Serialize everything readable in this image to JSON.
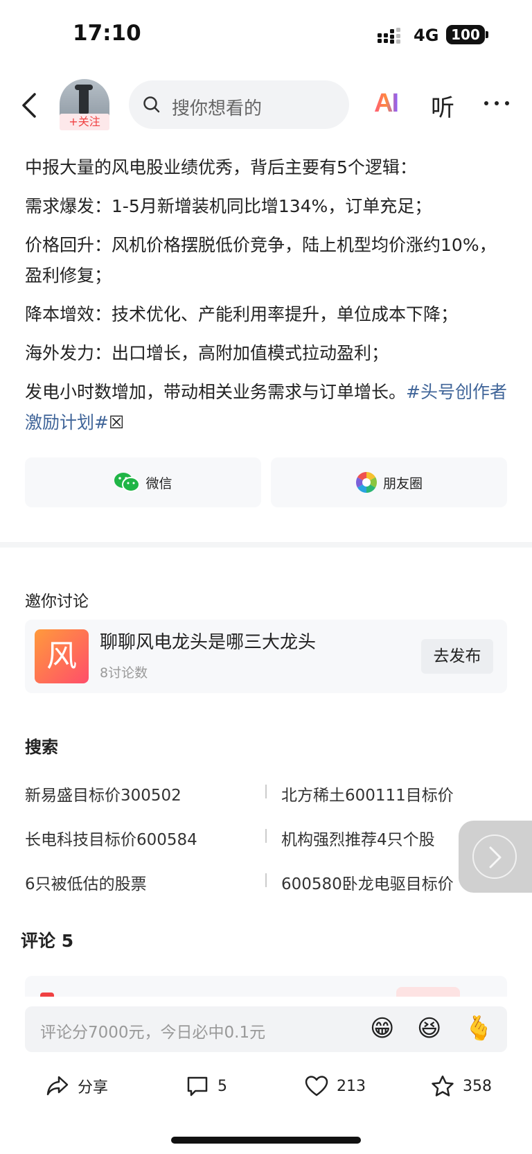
{
  "status_bar": {
    "time": "17:10",
    "network": "4G",
    "battery": "100"
  },
  "header": {
    "follow_label": "+关注",
    "search_placeholder": "搜你想看的",
    "ai_label": "AI",
    "listen_label": "听"
  },
  "article": {
    "paragraphs": [
      "中报大量的风电股业绩优秀，背后主要有5个逻辑：",
      "需求爆发：1-5月新增装机同比增134%，订单充足；",
      "价格回升：风机价格摆脱低价竞争，陆上机型均价涨约10%，盈利修复；",
      "降本增效：技术优化、产能利用率提升，单位成本下降；",
      "海外发力：出口增长，高附加值模式拉动盈利；",
      "发电小时数增加，带动相关业务需求与订单增长。"
    ],
    "hashtag": "#头号创作者激励计划#",
    "trailing_glyph": "☒"
  },
  "share": {
    "wechat_label": "微信",
    "moments_label": "朋友圈"
  },
  "discussion": {
    "section_title": "邀你讨论",
    "thumb_char": "风",
    "topic_title": "聊聊风电龙头是哪三大龙头",
    "topic_count": "8讨论数",
    "publish_label": "去发布"
  },
  "search_section": {
    "title": "搜索",
    "suggestions": [
      "新易盛目标价300502",
      "北方稀土600111目标价",
      "长电科技目标价600584",
      "机构强烈推荐4只个股",
      "6只被低估的股票",
      "600580卧龙电驱目标价"
    ]
  },
  "comments": {
    "title": "评论 5"
  },
  "input_bar": {
    "placeholder": "评论分7000元，今日必中0.1元",
    "emojis": [
      "😁",
      "😆",
      "🫰"
    ]
  },
  "actions": {
    "share_label": "分享",
    "comments_count": "5",
    "likes_count": "213",
    "favorites_count": "358"
  }
}
